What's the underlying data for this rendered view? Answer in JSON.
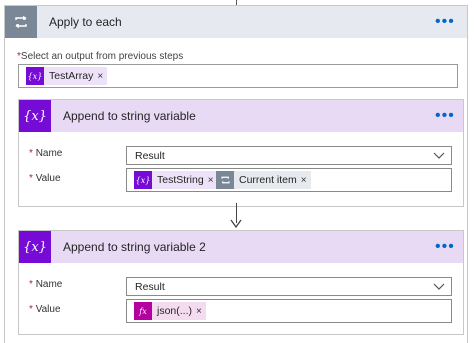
{
  "colors": {
    "variable_purple": "#770bd6",
    "variable_header": "#e8d9f4",
    "expression_magenta": "#b4009e",
    "loop_gray": "#7a8796",
    "accent_blue": "#0066cc"
  },
  "apply_to_each": {
    "title": "Apply to each",
    "menu_dots": "•••",
    "select_label_required": "*",
    "select_label": "Select an output from previous steps",
    "output_token": {
      "icon": "variable-icon",
      "label": "TestArray",
      "remove": "×"
    }
  },
  "actions": [
    {
      "title": "Append to string variable",
      "menu_dots": "•••",
      "name_label_required": "*",
      "name_label": "Name",
      "name_value": "Result",
      "value_label_required": "*",
      "value_label": "Value",
      "value_tokens": [
        {
          "icon": "variable-icon",
          "label": "TestString",
          "remove": "×"
        },
        {
          "icon": "loop-icon",
          "label": "Current item",
          "remove": "×"
        }
      ]
    },
    {
      "title": "Append to string variable 2",
      "menu_dots": "•••",
      "name_label_required": "*",
      "name_label": "Name",
      "name_value": "Result",
      "value_label_required": "*",
      "value_label": "Value",
      "value_tokens": [
        {
          "icon": "expression-icon",
          "label": "json(...)",
          "remove": "×"
        }
      ]
    }
  ],
  "icon_glyphs": {
    "variable": "{x}",
    "expression": "fx"
  }
}
